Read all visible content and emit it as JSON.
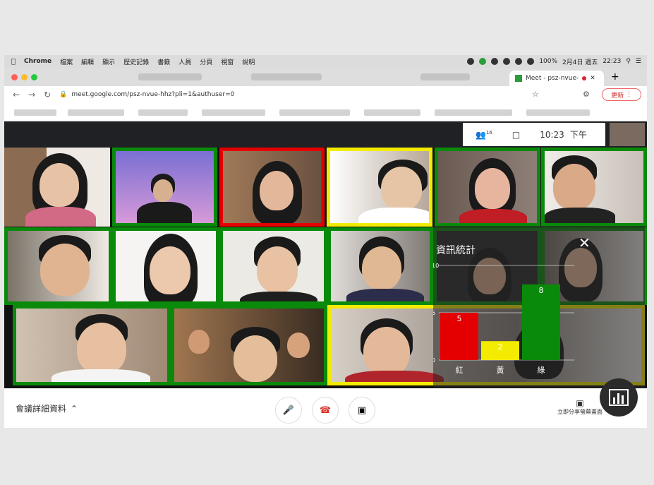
{
  "menubar": {
    "app": "Chrome",
    "items": [
      "檔案",
      "編輯",
      "顯示",
      "歷史記錄",
      "書籤",
      "人員",
      "分頁",
      "視窗",
      "說明"
    ],
    "battery": "100%",
    "date": "2月4日 週五",
    "time": "22:23"
  },
  "tab": {
    "title": "Meet - psz-nvue-"
  },
  "address": {
    "url": "meet.google.com/psz-nvue-hhz?pli=1&authuser=0",
    "update_label": "更新"
  },
  "meet": {
    "participant_count": "16",
    "clock": "10:23",
    "period": "下午"
  },
  "stats": {
    "title": "資訊統計",
    "ticks": [
      "10",
      "5",
      "0"
    ]
  },
  "chart_data": {
    "type": "bar",
    "title": "資訊統計",
    "categories": [
      "紅",
      "黃",
      "綠"
    ],
    "values": [
      5,
      2,
      8
    ],
    "ylim": [
      0,
      10
    ],
    "colors": [
      "#e40000",
      "#f4ec00",
      "#0a8a0a"
    ]
  },
  "bottombar": {
    "details_label": "會議詳細資料",
    "present_label": "立即分享螢幕畫面"
  }
}
